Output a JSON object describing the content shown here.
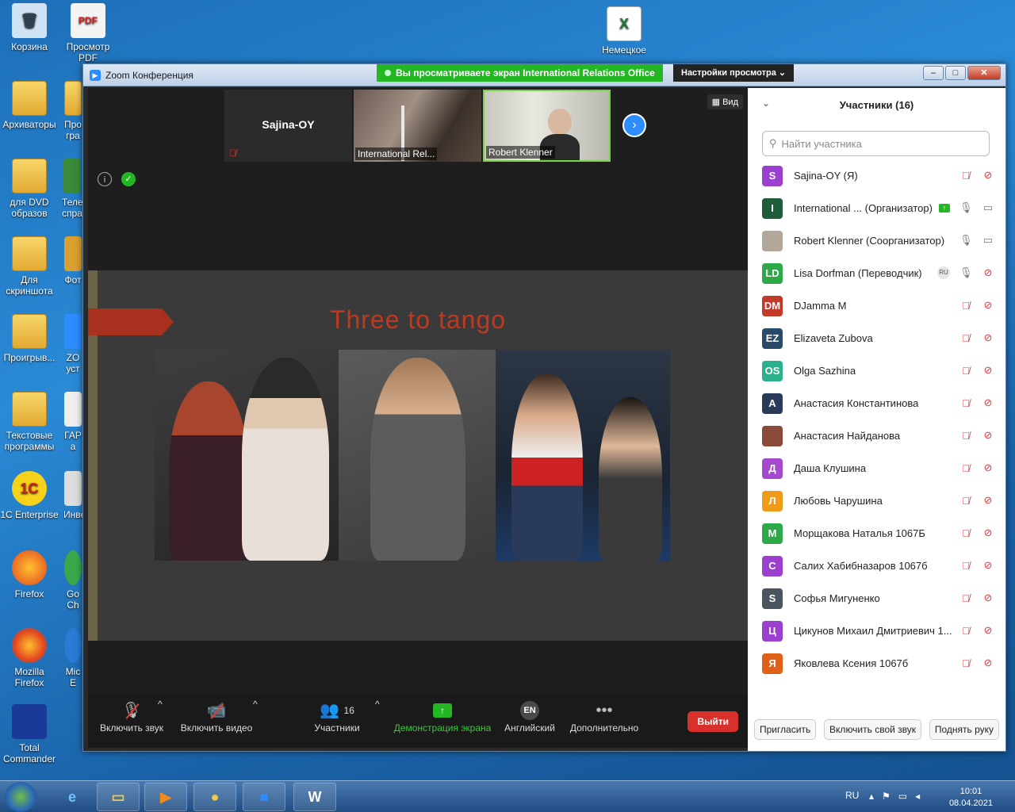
{
  "desktop": {
    "icons": [
      {
        "label": "Корзина",
        "glyph": "🗑"
      },
      {
        "label": "Просмотр PDF",
        "glyph": "PDF"
      },
      {
        "label": "Архиваторы",
        "glyph": ""
      },
      {
        "label": "Про гра",
        "glyph": ""
      },
      {
        "label": "для DVD образов",
        "glyph": ""
      },
      {
        "label": "Теле спра",
        "glyph": ""
      },
      {
        "label": "Для скриншота",
        "glyph": ""
      },
      {
        "label": "Фот",
        "glyph": ""
      },
      {
        "label": "Проигрыв...",
        "glyph": ""
      },
      {
        "label": "ZO уст",
        "glyph": ""
      },
      {
        "label": "Текстовые программы",
        "glyph": ""
      },
      {
        "label": "ГАР а",
        "glyph": ""
      },
      {
        "label": "1C Enterprise",
        "glyph": "1C"
      },
      {
        "label": "Инве",
        "glyph": ""
      },
      {
        "label": "Firefox",
        "glyph": ""
      },
      {
        "label": "Go Ch",
        "glyph": ""
      },
      {
        "label": "Mozilla Firefox",
        "glyph": ""
      },
      {
        "label": "Mic E",
        "glyph": ""
      },
      {
        "label": "Total Commander",
        "glyph": ""
      },
      {
        "label": "Немецкое",
        "glyph": "X"
      }
    ]
  },
  "window": {
    "title": "Zoom Конференция",
    "share_banner": "Вы просматриваете экран International Relations Office",
    "view_options": "Настройки просмотра",
    "view_options_caret": "⌄",
    "minimize": "–",
    "maximize": "□",
    "close": "✕"
  },
  "stage": {
    "thumbs": [
      {
        "name": "Sajina-OY",
        "type": "name-only"
      },
      {
        "name": "International Rel...",
        "type": "video"
      },
      {
        "name": "Robert Klenner",
        "type": "video"
      }
    ],
    "next_button": "›",
    "view_button": "Вид",
    "view_icon": "▦",
    "info_icon": "i",
    "shield_icon": "✓"
  },
  "slide": {
    "title": "Three to tango"
  },
  "toolbar": {
    "audio_label": "Включить звук",
    "video_label": "Включить видео",
    "participants_label": "Участники",
    "participants_count": "16",
    "share_label": "Демонстрация экрана",
    "language_label": "Английский",
    "language_code": "EN",
    "more_label": "Дополнительно",
    "leave_label": "Выйти",
    "caret": "^"
  },
  "panel": {
    "title": "Участники (16)",
    "collapse_icon": "⌄",
    "search_placeholder": "Найти участника",
    "participants": [
      {
        "initials": "S",
        "color": "#9b3fcf",
        "name": "Sajina-OY (Я)",
        "mic": "muted",
        "cam": "muted"
      },
      {
        "initials": "I",
        "color": "#1e5c3a",
        "name": "International ...  (Организатор)",
        "mic": "on",
        "cam": "on",
        "sharing": true
      },
      {
        "initials": "",
        "color": "#b3a79a",
        "name": "Robert Klenner (Соорганизатор)",
        "mic": "on",
        "cam": "on",
        "photo": true
      },
      {
        "initials": "LD",
        "color": "#2fa84a",
        "name": "Lisa Dorfman (Переводчик)",
        "mic": "on",
        "cam": "muted",
        "lang": "RU"
      },
      {
        "initials": "DM",
        "color": "#c23a2a",
        "name": "DJamma M",
        "mic": "muted",
        "cam": "muted"
      },
      {
        "initials": "EZ",
        "color": "#2a4a6a",
        "name": "Elizaveta Zubova",
        "mic": "muted",
        "cam": "muted"
      },
      {
        "initials": "OS",
        "color": "#2ab08a",
        "name": "Olga Sazhina",
        "mic": "muted",
        "cam": "muted"
      },
      {
        "initials": "А",
        "color": "#2a3a5a",
        "name": "Анастасия Константинова",
        "mic": "muted",
        "cam": "muted"
      },
      {
        "initials": "",
        "color": "#8a4a3a",
        "name": "Анастасия Найданова",
        "mic": "muted",
        "cam": "muted",
        "photo": true
      },
      {
        "initials": "Д",
        "color": "#a54acf",
        "name": "Даша Клушина",
        "mic": "muted",
        "cam": "muted"
      },
      {
        "initials": "Л",
        "color": "#f09a1a",
        "name": "Любовь Чарушина",
        "mic": "muted",
        "cam": "muted"
      },
      {
        "initials": "М",
        "color": "#2fa84a",
        "name": "Морщакова Наталья 1067Б",
        "mic": "muted",
        "cam": "muted"
      },
      {
        "initials": "С",
        "color": "#9b3fcf",
        "name": "Салих Хабибназаров 1067б",
        "mic": "muted",
        "cam": "muted"
      },
      {
        "initials": "S",
        "color": "#4a5560",
        "name": "Софья Мигуненко",
        "mic": "muted",
        "cam": "muted"
      },
      {
        "initials": "Ц",
        "color": "#9b3fcf",
        "name": "Цикунов Михаил Дмитриевич 1...",
        "mic": "muted",
        "cam": "muted"
      },
      {
        "initials": "Я",
        "color": "#e0601a",
        "name": "Яковлева Ксения 1067б",
        "mic": "muted",
        "cam": "muted"
      }
    ],
    "invite_label": "Пригласить",
    "unmute_self_label": "Включить свой звук",
    "raise_hand_label": "Поднять руку"
  },
  "taskbar": {
    "language": "RU",
    "time": "10:01",
    "date": "08.04.2021",
    "apps": [
      "explorer",
      "media-player",
      "chrome",
      "zoom",
      "word"
    ]
  }
}
